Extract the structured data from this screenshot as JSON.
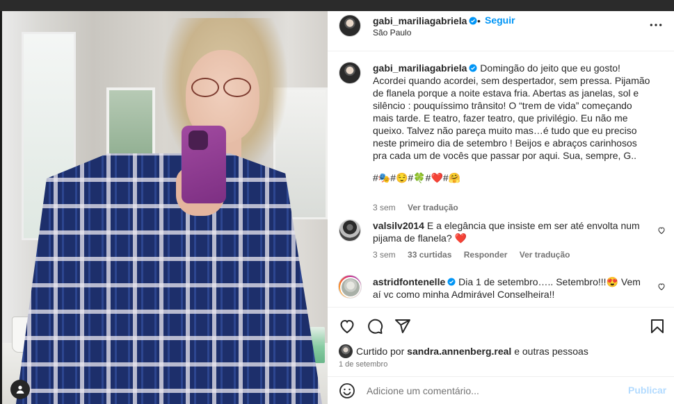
{
  "post": {
    "username": "gabi_mariliagabriela",
    "follow_label": "Seguir",
    "separator": "•",
    "location": "São Paulo",
    "caption": "Domingão do jeito que eu gosto! Acordei quando acordei, sem despertador, sem pressa. Pijamão de flanela porque a noite estava fria. Abertas as janelas, sol e silêncio : pouquíssimo trânsito! O “trem de vida” começando mais tarde. E teatro, fazer teatro, que privilégio. Eu não me queixo. Talvez não pareça muito mas…é tudo que eu preciso neste primeiro dia de setembro ! Beijos e abraços carinhosos pra cada um de vocês que passar por aqui. Sua, sempre, G..",
    "hashtags": "#🎭#😌#🍀#❤️#🤗",
    "caption_time": "3 sem",
    "see_translation": "Ver tradução"
  },
  "comments": [
    {
      "username": "valsilv2014",
      "text": "E a elegância que insiste em ser até envolta num pijama de flanela? ❤️",
      "time": "3 sem",
      "likes": "33 curtidas",
      "reply": "Responder",
      "translate": "Ver tradução"
    },
    {
      "username": "astridfontenelle",
      "text": "Dia 1 de setembro….. Setembro!!!😍 Vem aí vc como minha Admirável Conselheira!!"
    }
  ],
  "likes": {
    "prefix": "Curtido por",
    "user": "sandra.annenberg.real",
    "suffix": "e outras pessoas"
  },
  "date": "1 de setembro",
  "compose": {
    "placeholder": "Adicione um comentário...",
    "post_label": "Publicar"
  },
  "icons": [
    "more-icon",
    "verified-icon",
    "heart-icon",
    "comment-icon",
    "share-icon",
    "bookmark-icon",
    "emoji-icon",
    "user-icon"
  ],
  "colors": {
    "accent": "#0095f6",
    "post_disabled": "#b3dbff",
    "text": "#262626",
    "muted": "#737373",
    "like_red": "#ed4956"
  }
}
